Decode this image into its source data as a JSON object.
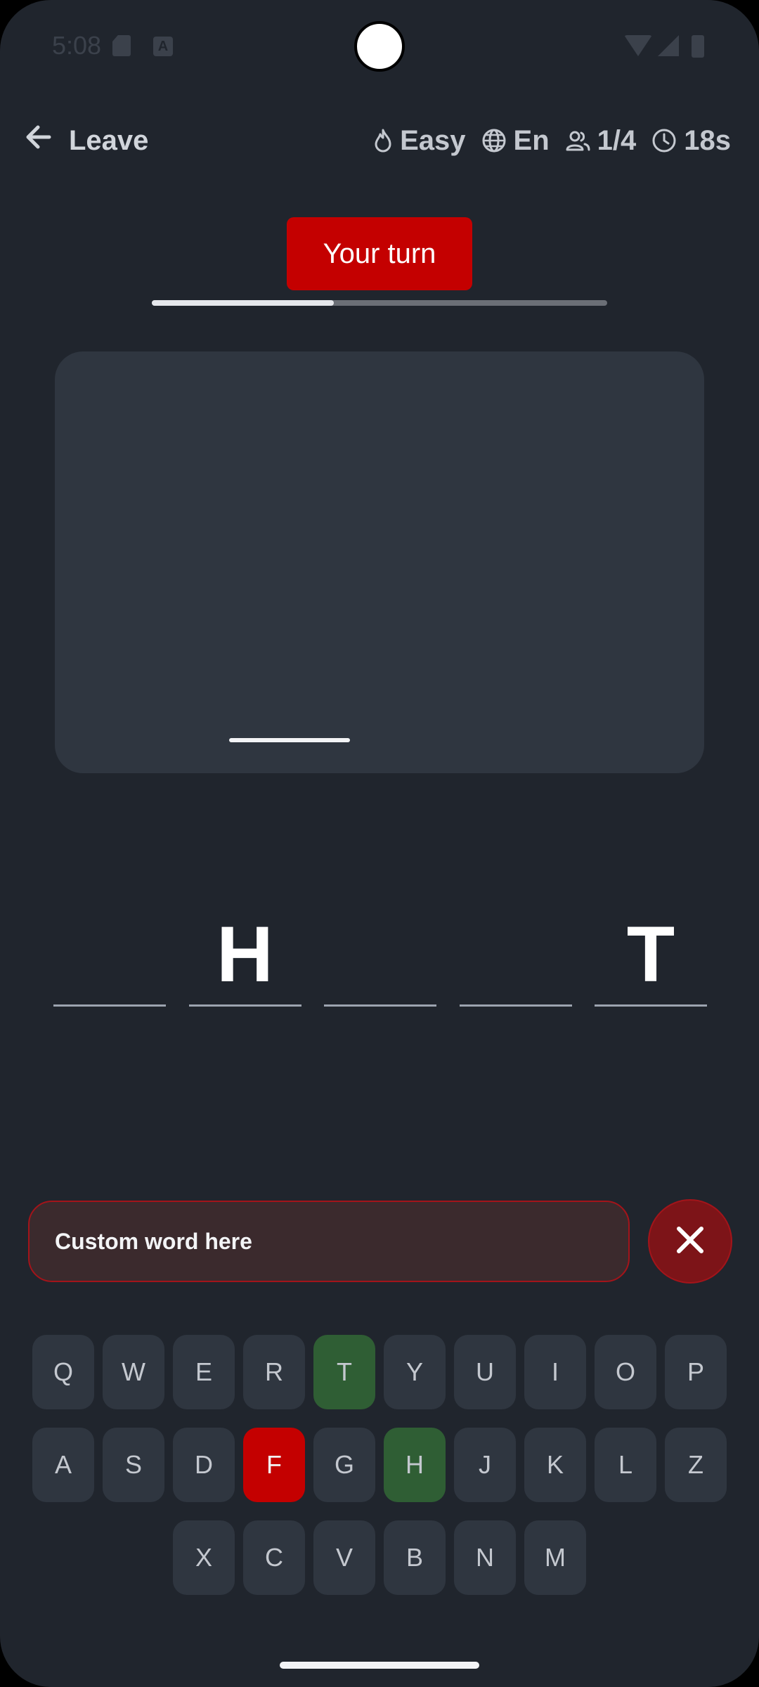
{
  "status_bar": {
    "time": "5:08"
  },
  "header": {
    "back_label": "Leave",
    "difficulty": "Easy",
    "language": "En",
    "players": "1/4",
    "timer": "18s"
  },
  "turn": {
    "label": "Your turn",
    "progress": 0.4
  },
  "word": {
    "slots": [
      "",
      "H",
      "",
      "",
      "T"
    ]
  },
  "input": {
    "placeholder": "Custom word here",
    "value": ""
  },
  "keyboard": {
    "row1": [
      {
        "key": "Q",
        "state": "default"
      },
      {
        "key": "W",
        "state": "default"
      },
      {
        "key": "E",
        "state": "default"
      },
      {
        "key": "R",
        "state": "default"
      },
      {
        "key": "T",
        "state": "correct"
      },
      {
        "key": "Y",
        "state": "default"
      },
      {
        "key": "U",
        "state": "default"
      },
      {
        "key": "I",
        "state": "default"
      },
      {
        "key": "O",
        "state": "default"
      },
      {
        "key": "P",
        "state": "default"
      }
    ],
    "row2": [
      {
        "key": "A",
        "state": "default"
      },
      {
        "key": "S",
        "state": "default"
      },
      {
        "key": "D",
        "state": "default"
      },
      {
        "key": "F",
        "state": "wrong"
      },
      {
        "key": "G",
        "state": "default"
      },
      {
        "key": "H",
        "state": "correct"
      },
      {
        "key": "J",
        "state": "default"
      },
      {
        "key": "K",
        "state": "default"
      },
      {
        "key": "L",
        "state": "default"
      },
      {
        "key": "Z",
        "state": "default"
      }
    ],
    "row3": [
      {
        "key": "X",
        "state": "default"
      },
      {
        "key": "C",
        "state": "default"
      },
      {
        "key": "V",
        "state": "default"
      },
      {
        "key": "B",
        "state": "default"
      },
      {
        "key": "N",
        "state": "default"
      },
      {
        "key": "M",
        "state": "default"
      }
    ]
  },
  "icons": {
    "back": "arrow-left-icon",
    "difficulty": "flame-icon",
    "language": "globe-icon",
    "players": "users-icon",
    "timer": "clock-icon",
    "clear": "close-icon"
  },
  "colors": {
    "background": "#20252d",
    "accent": "#c40000",
    "correct": "#2f5e34",
    "key": "#2f3640"
  }
}
